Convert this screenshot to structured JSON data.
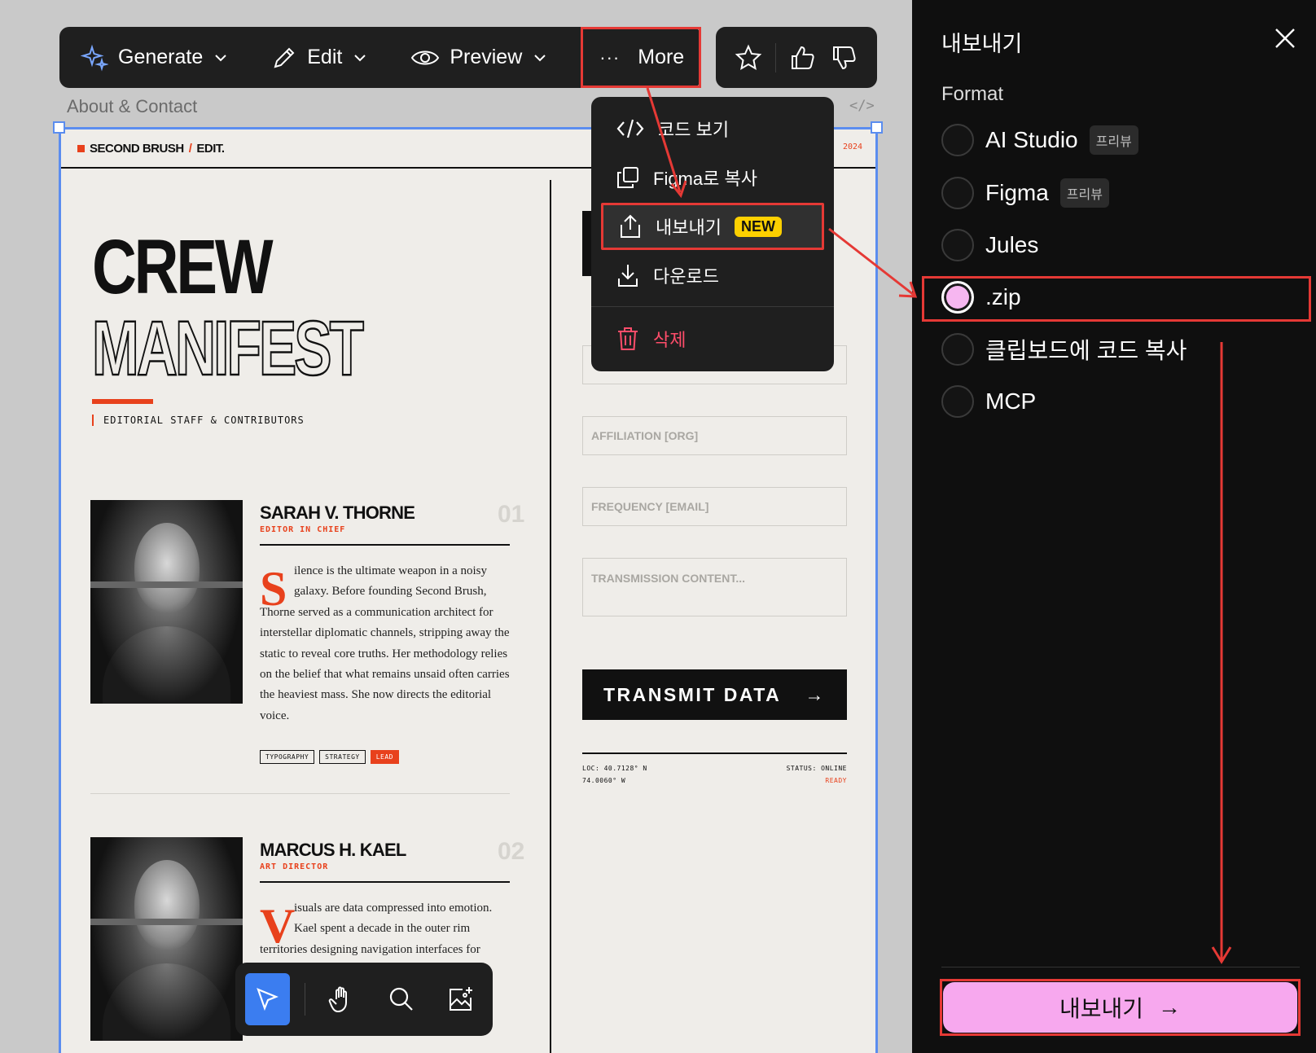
{
  "toolbar": {
    "generate": "Generate",
    "edit": "Edit",
    "preview": "Preview",
    "more_dots": "···",
    "more": "More"
  },
  "breadcrumb": "About & Contact",
  "code_tag": "</>",
  "site": {
    "brand_name": "SECOND BRUSH",
    "brand_slash": "/",
    "brand_suffix": "EDIT.",
    "year": "2024",
    "title_line1": "CREW",
    "title_line2": "MANIFEST",
    "subtitle": "EDITORIAL STAFF & CONTRIBUTORS",
    "members": [
      {
        "name": "SARAH V. THORNE",
        "role": "EDITOR IN CHIEF",
        "number": "01",
        "dropcap": "S",
        "bio_lines": [
          "ilence is the ultimate weapon in a noisy",
          "galaxy. Before founding Second Brush,",
          "Thorne served as a communication architect for",
          "interstellar diplomatic channels, stripping away the",
          "static to reveal core truths. Her methodology relies",
          "on the belief that what remains unsaid often carries",
          "the heaviest mass. She now directs the editorial",
          "voice."
        ],
        "tags": [
          "TYPOGRAPHY",
          "STRATEGY",
          "LEAD"
        ]
      },
      {
        "name": "MARCUS H. KAEL",
        "role": "ART DIRECTOR",
        "number": "02",
        "dropcap": "V",
        "bio_lines": [
          "isuals are data compressed into emotion.",
          "Kael spent a decade in the outer rim",
          "territories designing navigation interfaces for"
        ]
      }
    ],
    "form": {
      "affiliation": "AFFILIATION [ORG]",
      "frequency": "FREQUENCY [EMAIL]",
      "content": "TRANSMISSION CONTENT...",
      "submit": "TRANSMIT DATA",
      "submit_arrow": "→",
      "loc_line1": "LOC: 40.7128° N",
      "loc_line2": "74.0060° W",
      "status": "STATUS: ONLINE",
      "ready": "READY"
    }
  },
  "menu": {
    "view_code": "코드 보기",
    "copy_figma": "Figma로 복사",
    "export": "내보내기",
    "new_badge": "NEW",
    "download": "다운로드",
    "delete": "삭제"
  },
  "panel": {
    "title": "내보내기",
    "format_label": "Format",
    "options": [
      {
        "label": "AI Studio",
        "badge": "프리뷰",
        "selected": false
      },
      {
        "label": "Figma",
        "badge": "프리뷰",
        "selected": false
      },
      {
        "label": "Jules",
        "selected": false
      },
      {
        "label": ".zip",
        "selected": true
      },
      {
        "label": "클립보드에 코드 복사",
        "selected": false
      },
      {
        "label": "MCP",
        "selected": false
      }
    ],
    "export_button": "내보내기",
    "export_arrow": "→"
  },
  "colors": {
    "accent_red": "#e8411c",
    "annotation_red": "#e53935",
    "selection_blue": "#5b8def",
    "export_pink": "#f7a8ee",
    "new_yellow": "#fdd000"
  }
}
